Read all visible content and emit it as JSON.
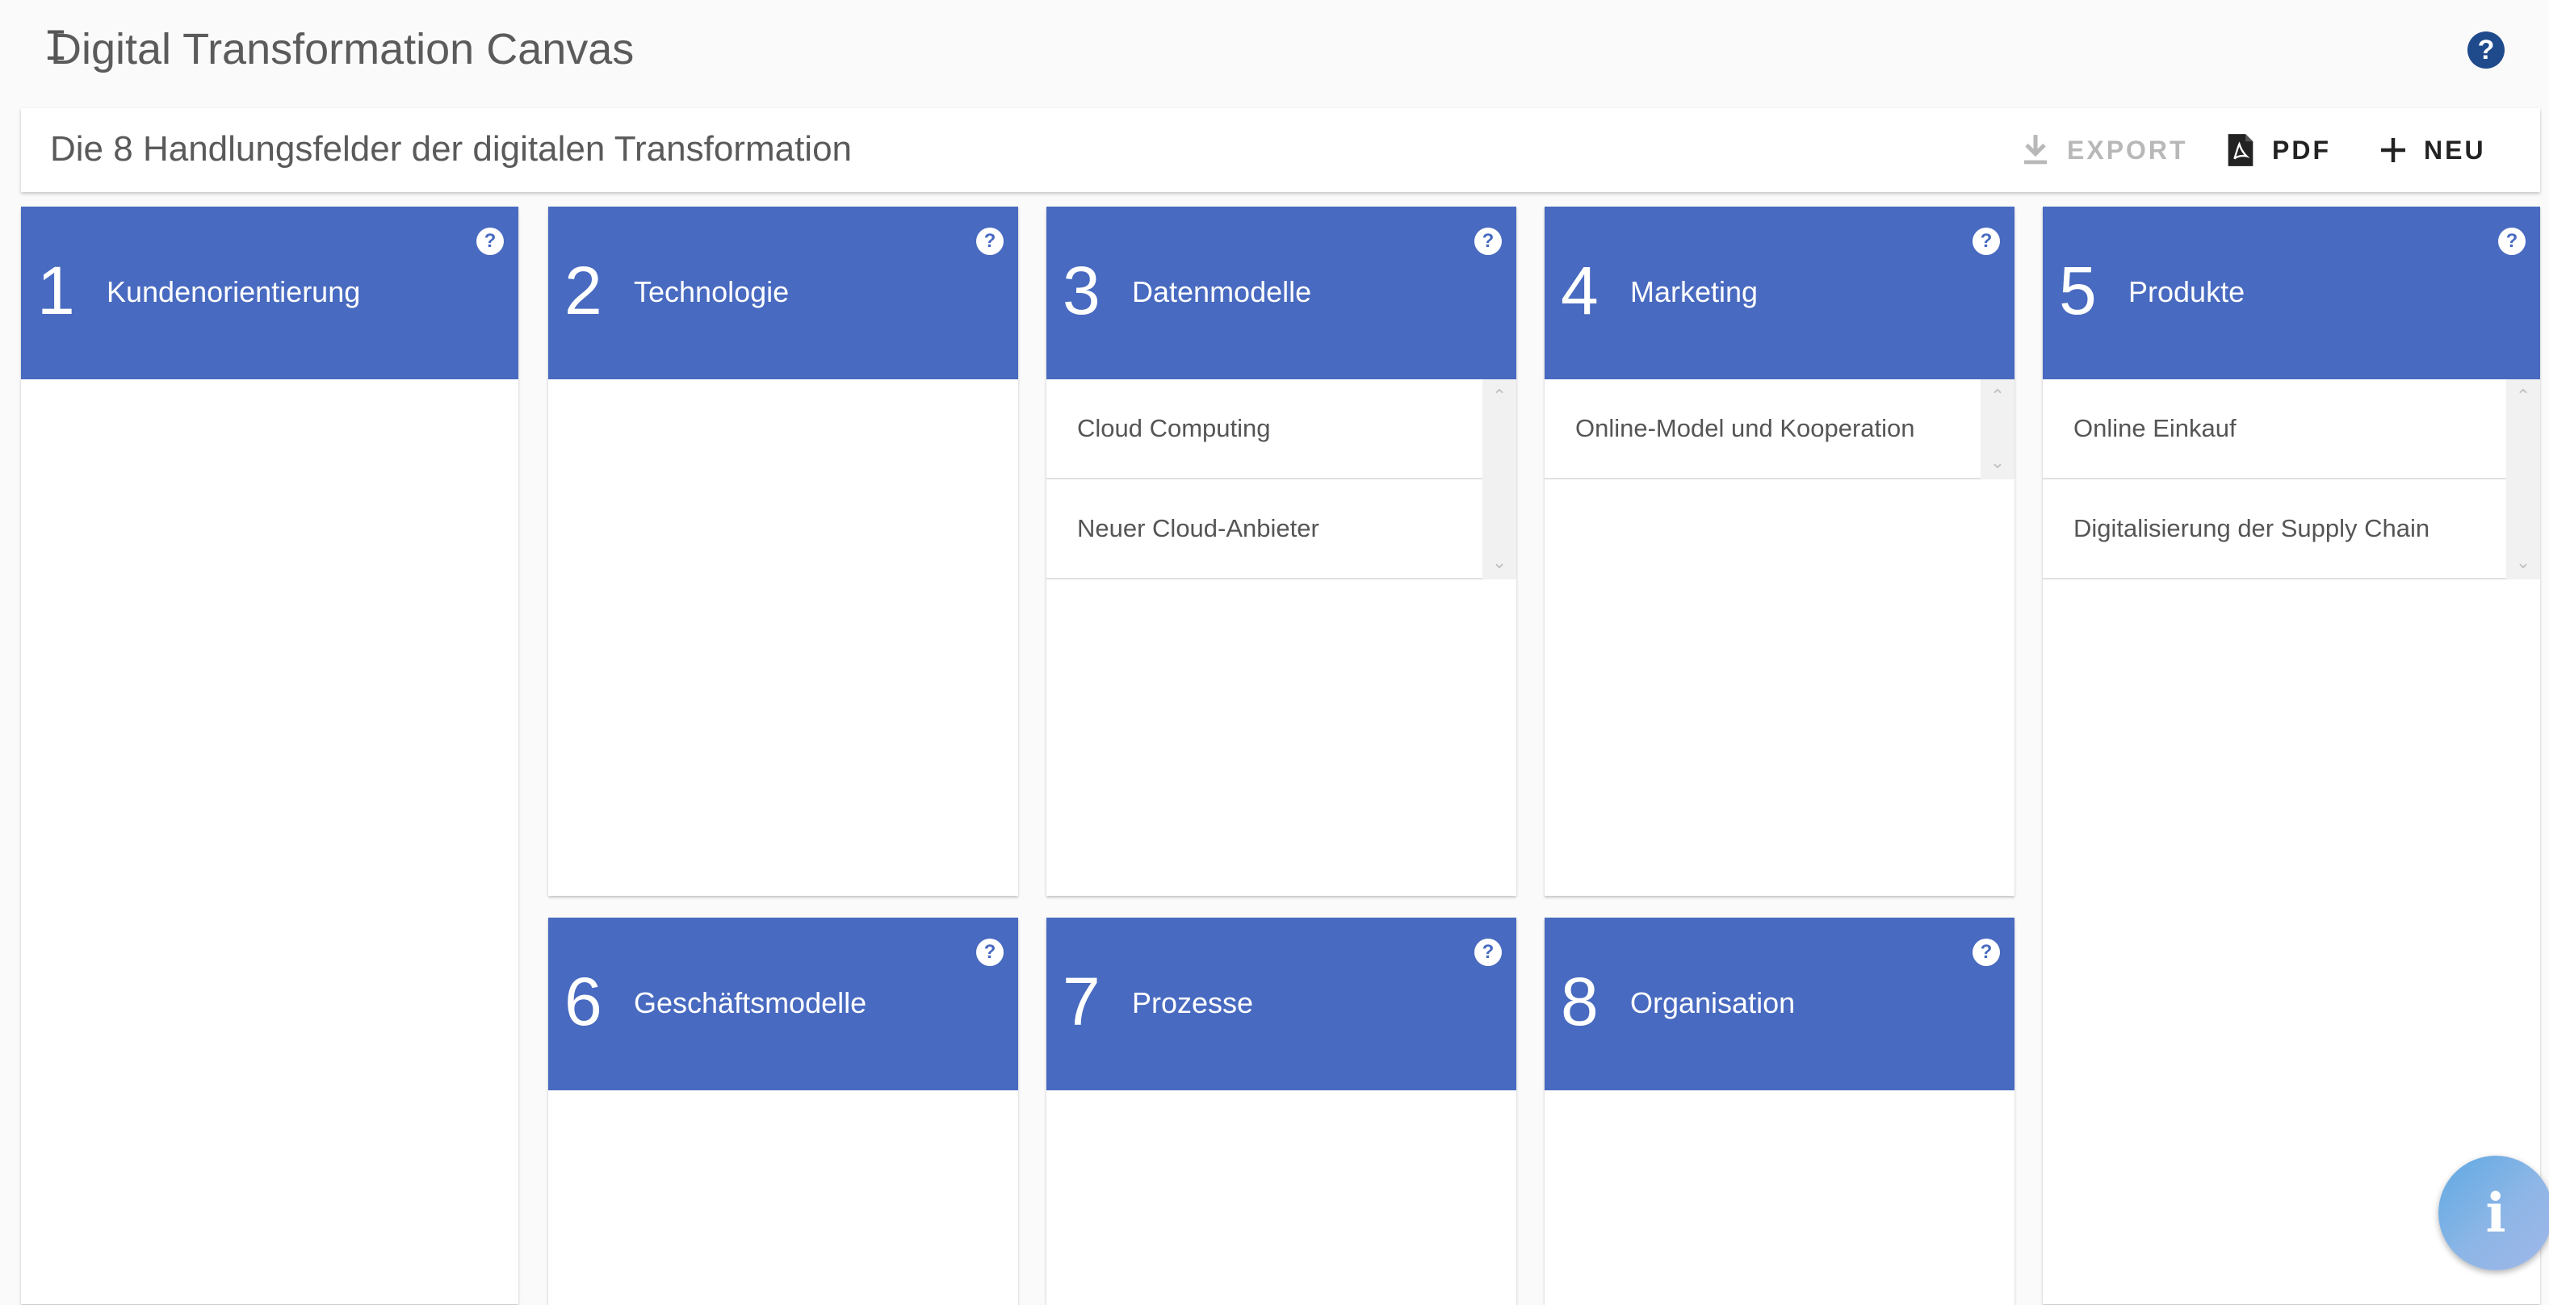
{
  "app": {
    "title": "Digital Transformation Canvas",
    "cursor_glyph": "I",
    "help_glyph": "?"
  },
  "toolbar": {
    "title": "Die 8 Handlungsfelder der digitalen Transformation",
    "export_label": "EXPORT",
    "pdf_label": "PDF",
    "new_label": "NEU"
  },
  "cards": [
    {
      "num": "1",
      "title": "Kundenorientierung",
      "items": []
    },
    {
      "num": "2",
      "title": "Technologie",
      "items": []
    },
    {
      "num": "3",
      "title": "Datenmodelle",
      "items": [
        "Cloud Computing",
        "Neuer Cloud-Anbieter"
      ]
    },
    {
      "num": "4",
      "title": "Marketing",
      "items": [
        "Online-Model und Kooperation"
      ]
    },
    {
      "num": "5",
      "title": "Produkte",
      "items": [
        "Online Einkauf",
        "Digitalisierung der Supply Chain"
      ]
    },
    {
      "num": "6",
      "title": "Geschäftsmodelle",
      "items": []
    },
    {
      "num": "7",
      "title": "Prozesse",
      "items": []
    },
    {
      "num": "8",
      "title": "Organisation",
      "items": []
    }
  ],
  "card_help_glyph": "?",
  "fab_glyph": "i",
  "colors": {
    "card_header": "#486ac0",
    "help_icon": "#1f4a8c",
    "background": "#fafafa"
  }
}
